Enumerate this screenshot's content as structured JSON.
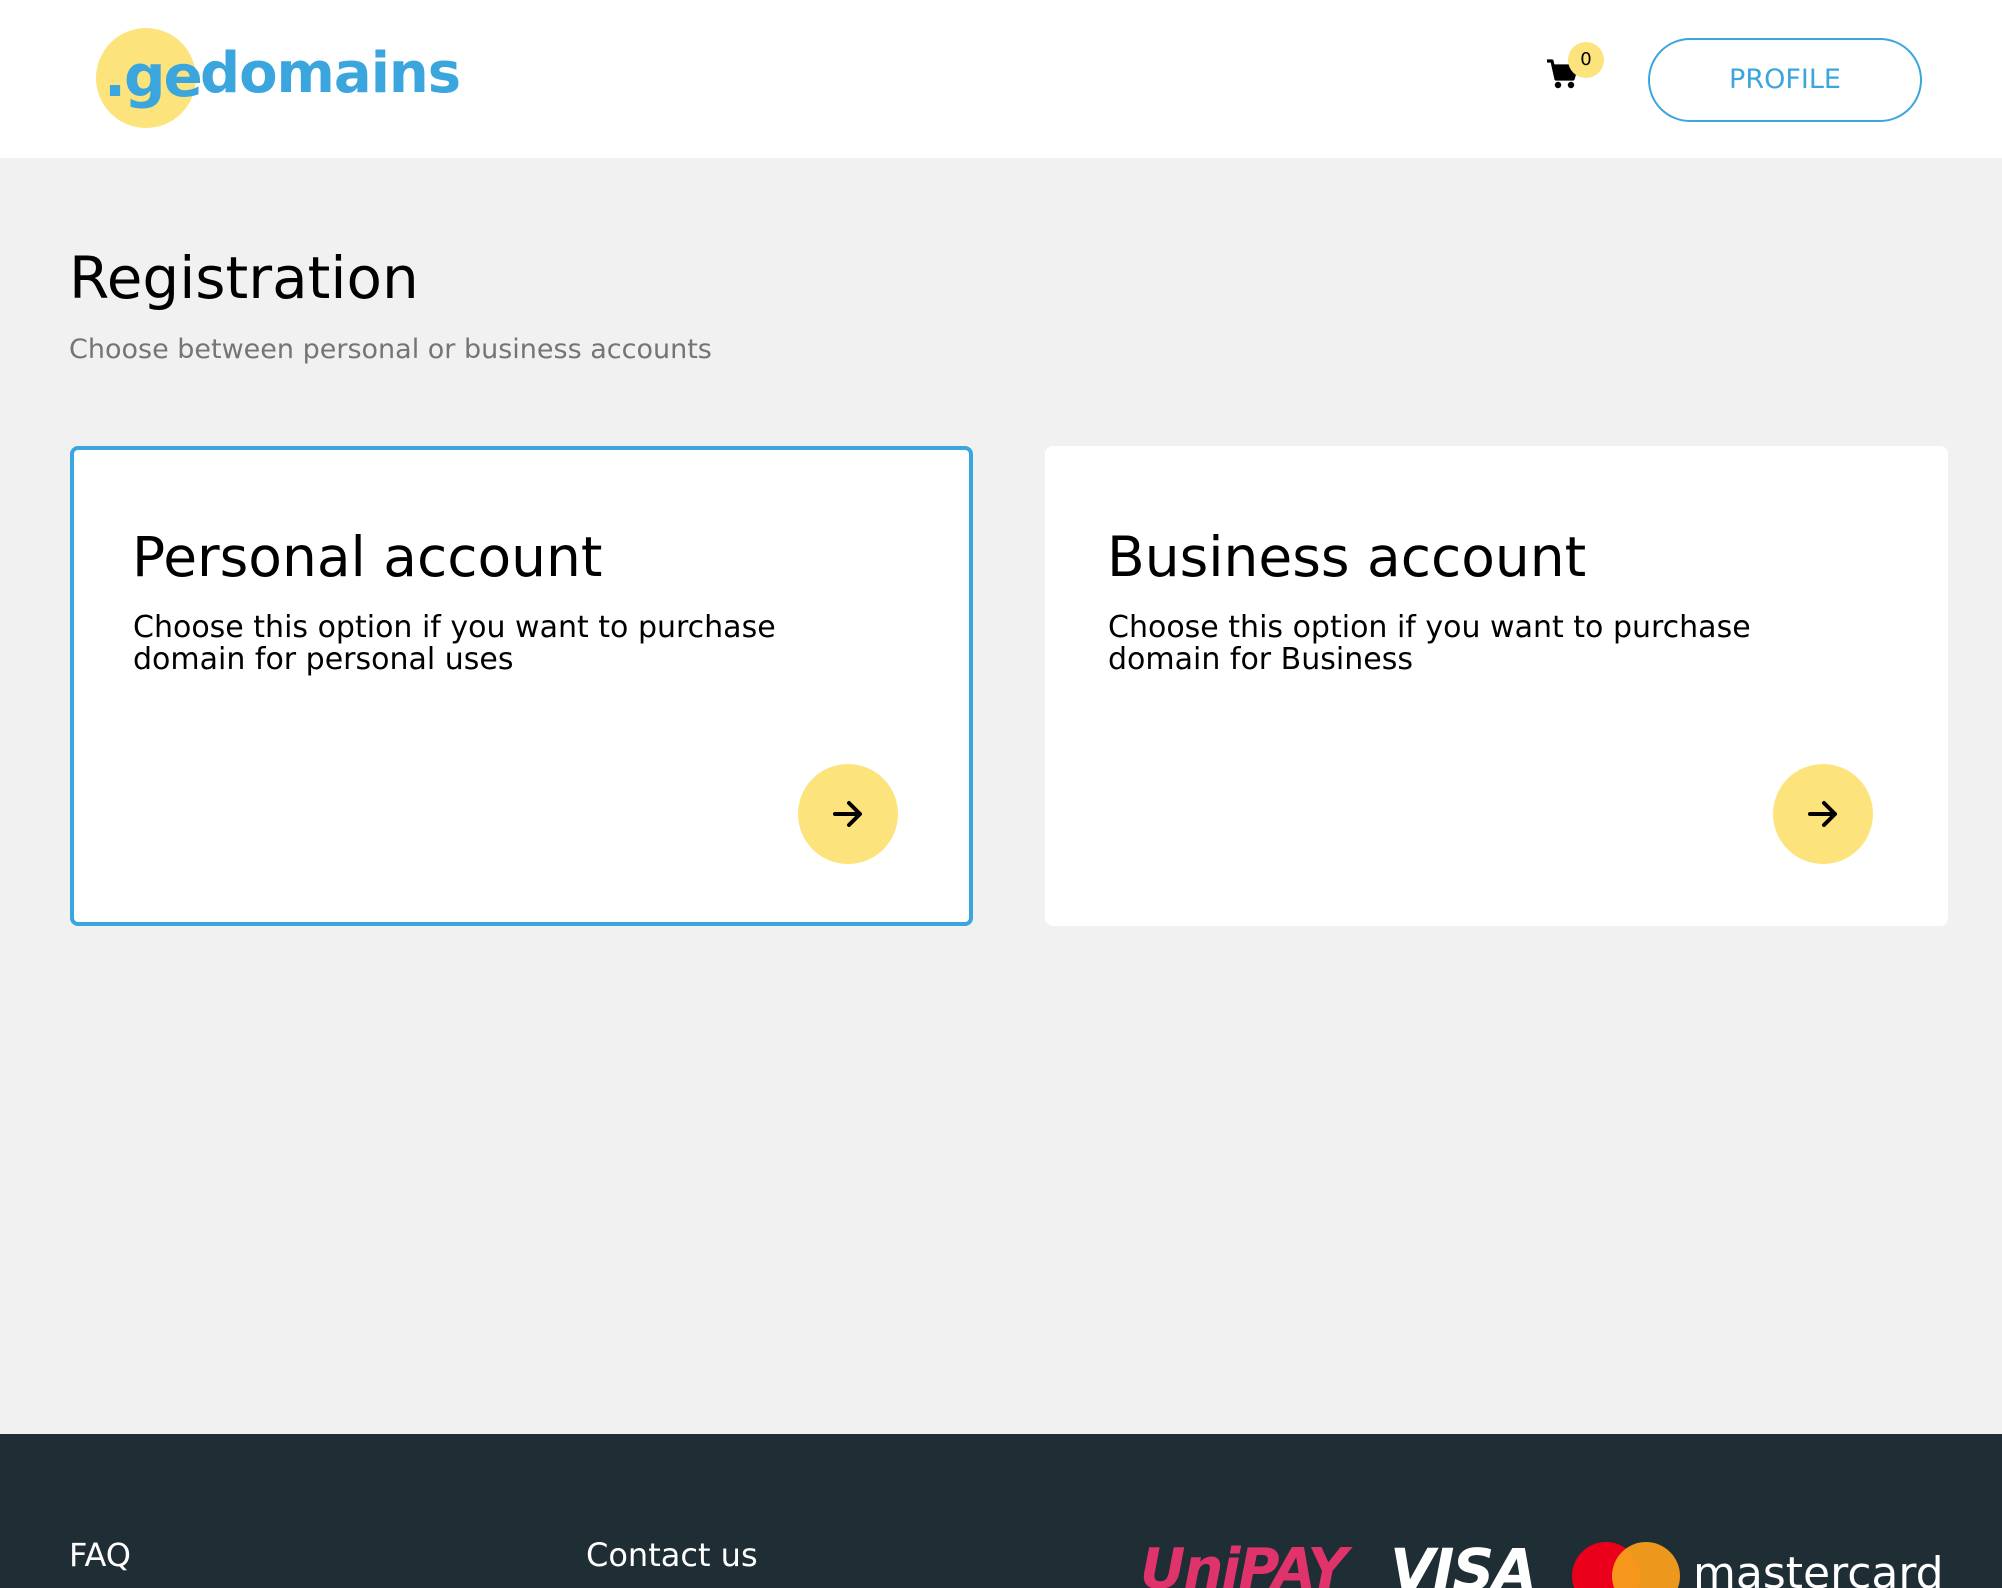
{
  "header": {
    "logo_prefix": ".ge",
    "logo_name": "domains",
    "cart_count": "0",
    "profile_label": "PROFILE"
  },
  "main": {
    "title": "Registration",
    "subtitle": "Choose between personal or business accounts",
    "cards": [
      {
        "title": "Personal account",
        "description": "Choose this option if you want to purchase domain for personal uses",
        "selected": true
      },
      {
        "title": "Business account",
        "description": "Choose this option if you want to purchase domain for Business",
        "selected": false
      }
    ]
  },
  "footer": {
    "faq_label": "FAQ",
    "contact_label": "Contact us",
    "payment_logos": [
      "UniPAY",
      "VISA",
      "mastercard"
    ]
  },
  "colors": {
    "accent_blue": "#3aa6dd",
    "accent_yellow": "#fde37c",
    "footer_bg": "#1f2d35",
    "page_bg": "#f1f1f1"
  }
}
